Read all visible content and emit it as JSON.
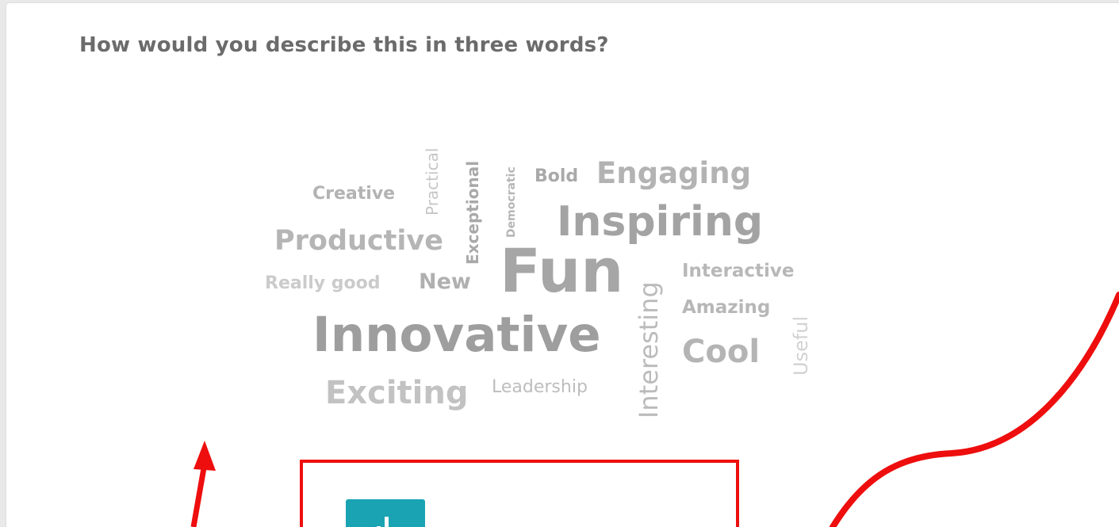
{
  "question": "How would you describe this in three words?",
  "word_cloud": {
    "text_color": "#9e9e9e",
    "words": [
      "Creative",
      "Practical",
      "Exceptional",
      "Democratic",
      "Bold",
      "Engaging",
      "Inspiring",
      "Productive",
      "Fun",
      "Really good",
      "New",
      "Interactive",
      "Interesting",
      "Amazing",
      "Useful",
      "Innovative",
      "Cool",
      "Exciting",
      "Leadership"
    ]
  },
  "colors": {
    "annotation_red": "#ee0e0e",
    "tile_teal": "#1aa3b3",
    "question_text": "#6b6b6b"
  },
  "icons": {
    "tile_icon": "bar-chart-icon"
  }
}
